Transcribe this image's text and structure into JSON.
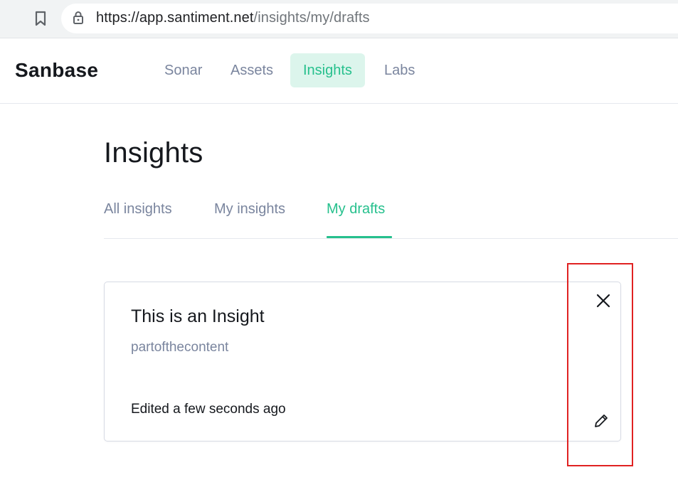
{
  "browser": {
    "url_host": "https://app.santiment.net",
    "url_path": "/insights/my/drafts",
    "icons": [
      "bookmark-icon",
      "lock-icon"
    ]
  },
  "nav": {
    "logo": "Sanbase",
    "items": [
      {
        "label": "Sonar",
        "active": false
      },
      {
        "label": "Assets",
        "active": false
      },
      {
        "label": "Insights",
        "active": true
      },
      {
        "label": "Labs",
        "active": false
      }
    ]
  },
  "page": {
    "title": "Insights",
    "tabs": [
      {
        "label": "All insights",
        "active": false
      },
      {
        "label": "My insights",
        "active": false
      },
      {
        "label": "My drafts",
        "active": true
      }
    ]
  },
  "draft_card": {
    "title": "This is an Insight",
    "snippet": "partofthecontent",
    "edited": "Edited a few seconds ago",
    "icons": [
      "close-icon",
      "pencil-icon"
    ]
  },
  "colors": {
    "accent": "#26c08d",
    "accent_bg": "#dcf5ec",
    "muted_text": "#7a859e",
    "annotation": "#e02222"
  }
}
